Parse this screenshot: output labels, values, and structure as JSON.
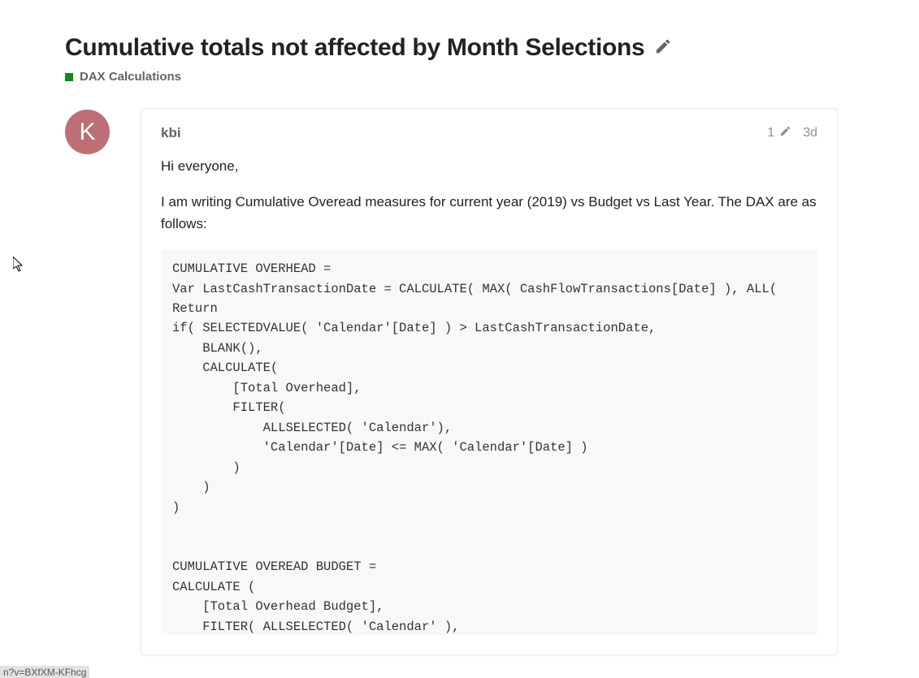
{
  "topic": {
    "title": "Cumulative totals not affected by Month Selections",
    "category": "DAX Calculations",
    "categoryColor": "#0E8A16"
  },
  "post": {
    "authorInitial": "K",
    "username": "kbi",
    "editCount": "1",
    "timestamp": "3d",
    "greeting": "Hi everyone,",
    "intro": "I am writing Cumulative Overead measures for current year (2019) vs Budget vs Last Year. The DAX are as follows:",
    "code": "CUMULATIVE OVERHEAD = \nVar LastCashTransactionDate = CALCULATE( MAX( CashFlowTransactions[Date] ), ALL( \nReturn\nif( SELECTEDVALUE( 'Calendar'[Date] ) > LastCashTransactionDate,\n    BLANK(),\n    CALCULATE(\n        [Total Overhead],\n        FILTER(\n            ALLSELECTED( 'Calendar'),\n            'Calendar'[Date] <= MAX( 'Calendar'[Date] )\n        )\n    )\n)\n\n\nCUMULATIVE OVEREAD BUDGET = \nCALCULATE (\n    [Total Overhead Budget],\n    FILTER( ALLSELECTED( 'Calendar' ),\n        'Calendar'[Date] <= MAX( 'Calendar'[Date] )\n    )\n)"
  },
  "footer": {
    "urlFragment": "n?v=BXfXM-KFhcg"
  }
}
